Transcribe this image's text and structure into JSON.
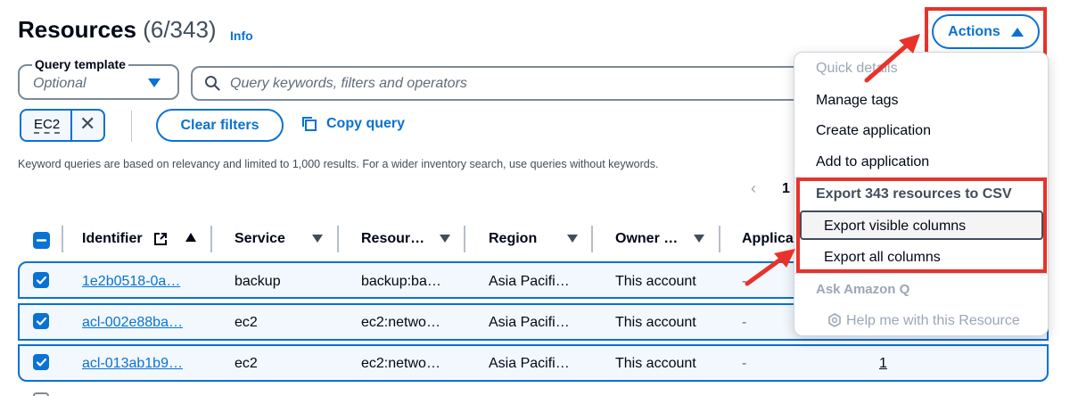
{
  "header": {
    "title": "Resources",
    "count": "(6/343)",
    "info_link": "Info",
    "actions_label": "Actions"
  },
  "query_template": {
    "label": "Query template",
    "placeholder": "Optional"
  },
  "search": {
    "placeholder": "Query keywords, filters and operators"
  },
  "filter_token": {
    "label": "EC2"
  },
  "buttons": {
    "clear_filters": "Clear filters",
    "copy_query": "Copy query"
  },
  "note": "Keyword queries are based on relevancy and limited to 1,000 results. For a wider inventory search, use queries without keywords.",
  "pagination": {
    "current_page": "1"
  },
  "table": {
    "columns": [
      "Identifier",
      "Service",
      "Resour…",
      "Region",
      "Owner …",
      "Applica"
    ],
    "rows": [
      {
        "identifier": "1e2b0518-0a…",
        "service": "backup",
        "resource": "backup:ba…",
        "region": "Asia Pacifi…",
        "owner": "This account",
        "app": "-",
        "extra": ""
      },
      {
        "identifier": "acl-002e88ba…",
        "service": "ec2",
        "resource": "ec2:netwo…",
        "region": "Asia Pacifi…",
        "owner": "This account",
        "app": "-",
        "extra": ""
      },
      {
        "identifier": "acl-013ab1b9…",
        "service": "ec2",
        "resource": "ec2:netwo…",
        "region": "Asia Pacifi…",
        "owner": "This account",
        "app": "-",
        "extra": "1"
      }
    ]
  },
  "menu": {
    "quick_details": "Quick details",
    "manage_tags": "Manage tags",
    "create_application": "Create application",
    "add_to_application": "Add to application",
    "export_group": "Export 343 resources to CSV",
    "export_visible": "Export visible columns",
    "export_all": "Export all columns",
    "ask_q": "Ask Amazon Q",
    "help_resource": "Help me with this Resource"
  },
  "colors": {
    "accent": "#0972d3",
    "highlight": "#e8322a",
    "selected_row_bg": "#f2f8fd"
  }
}
